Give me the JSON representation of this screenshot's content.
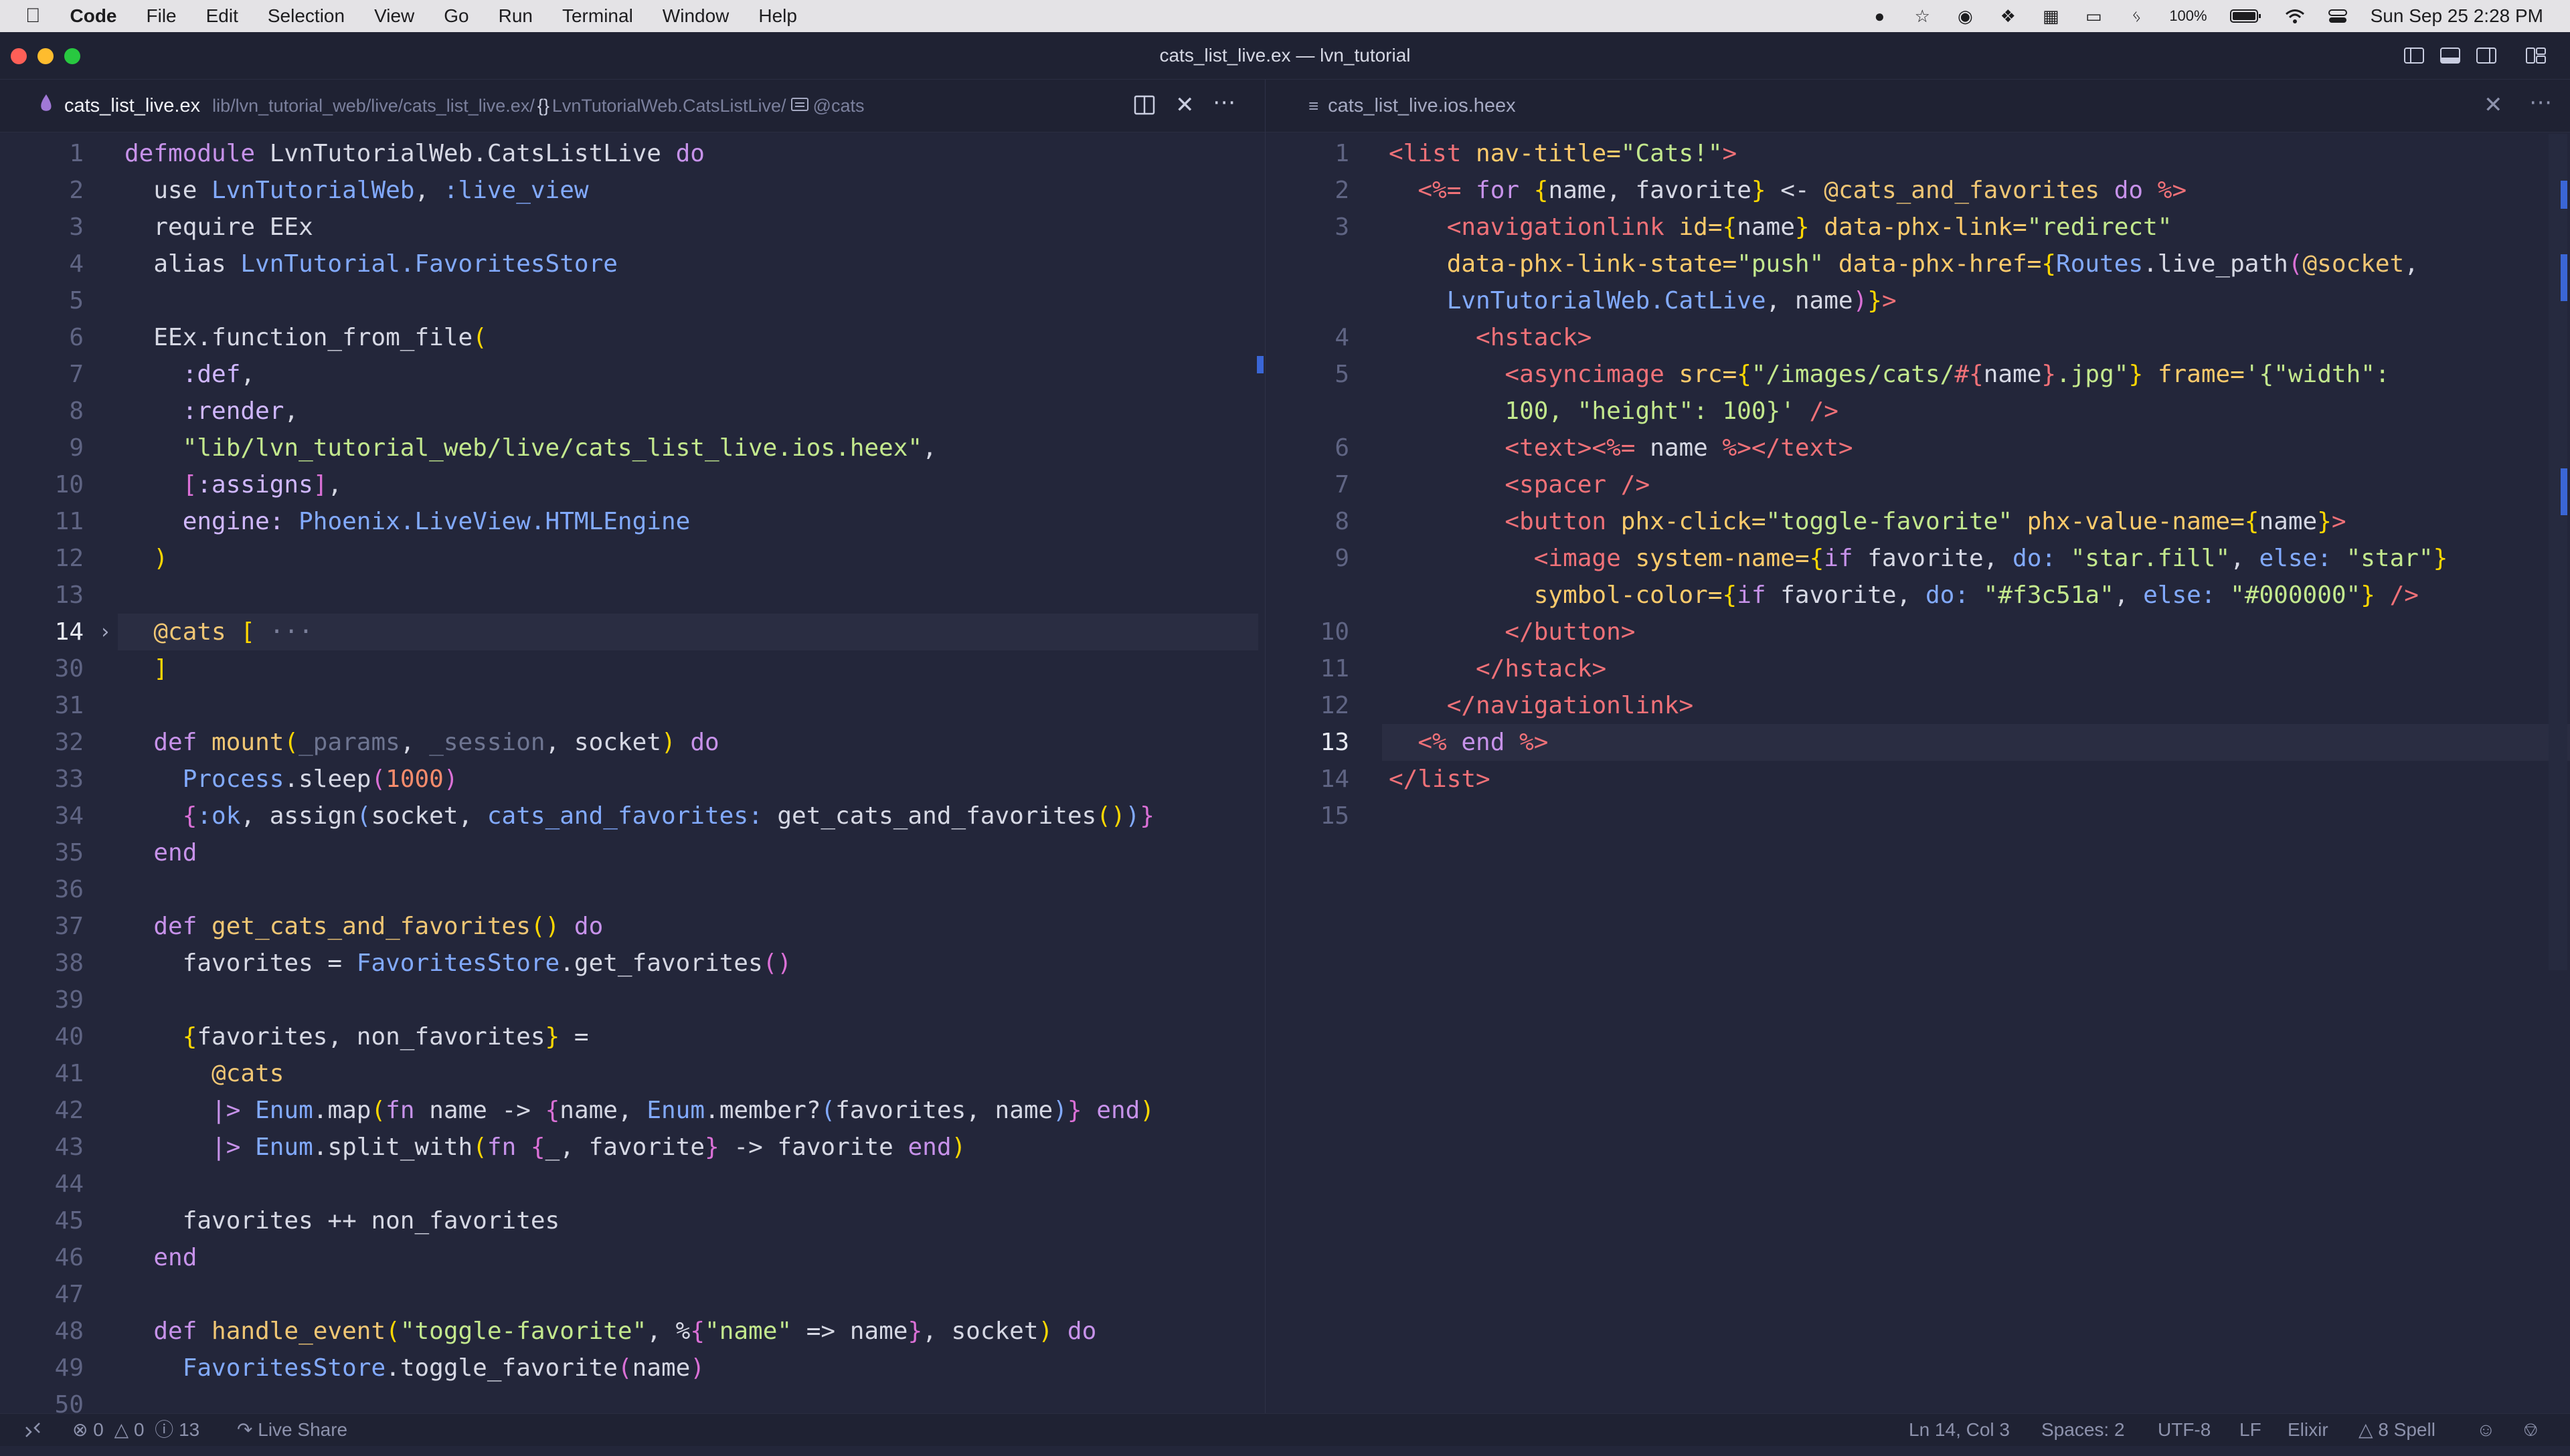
{
  "menubar": {
    "items": [
      "Code",
      "File",
      "Edit",
      "Selection",
      "View",
      "Go",
      "Run",
      "Terminal",
      "Window",
      "Help"
    ],
    "battery": "100%",
    "datetime": "Sun Sep 25  2:28 PM"
  },
  "window": {
    "title": "cats_list_live.ex — lvn_tutorial"
  },
  "left_tab": {
    "name": "cats_list_live.ex",
    "breadcrumb_path": "lib/lvn_tutorial_web/live/cats_list_live.ex/",
    "breadcrumb_module": "LvnTutorialWeb.CatsListLive/",
    "breadcrumb_attr": "@cats"
  },
  "right_tab": {
    "name": "cats_list_live.ios.heex"
  },
  "left_lines": [
    {
      "n": "1",
      "t": [
        [
          "defmodule ",
          "#c792ea"
        ],
        [
          "LvnTutorialWeb.CatsListLive ",
          "#d6d8e4"
        ],
        [
          "do",
          "#c792ea"
        ]
      ]
    },
    {
      "n": "2",
      "t": [
        [
          "  use ",
          "#d6d8e4"
        ],
        [
          "LvnTutorialWeb",
          "#82aaff"
        ],
        [
          ", ",
          "#d6d8e4"
        ],
        [
          ":live_view",
          "#82aaff"
        ]
      ]
    },
    {
      "n": "3",
      "t": [
        [
          "  require EEx",
          "#d6d8e4"
        ]
      ]
    },
    {
      "n": "4",
      "t": [
        [
          "  alias ",
          "#d6d8e4"
        ],
        [
          "LvnTutorial.FavoritesStore",
          "#82aaff"
        ]
      ]
    },
    {
      "n": "5",
      "t": []
    },
    {
      "n": "6",
      "t": [
        [
          "  EEx.function_from_file",
          "#d6d8e4"
        ],
        [
          "(",
          "#ffd700"
        ]
      ]
    },
    {
      "n": "7",
      "t": [
        [
          "    :def",
          "#d0b7ff"
        ],
        [
          ",",
          "#d6d8e4"
        ]
      ]
    },
    {
      "n": "8",
      "t": [
        [
          "    :render",
          "#d0b7ff"
        ],
        [
          ",",
          "#d6d8e4"
        ]
      ]
    },
    {
      "n": "9",
      "t": [
        [
          "    \"lib/lvn_tutorial_web/live/cats_list_live.ios.heex\"",
          "#c3e88d"
        ],
        [
          ",",
          "#d6d8e4"
        ]
      ]
    },
    {
      "n": "10",
      "t": [
        [
          "    [",
          "#da70d6"
        ],
        [
          ":assigns",
          "#d0b7ff"
        ],
        [
          "]",
          "#da70d6"
        ],
        [
          ",",
          "#d6d8e4"
        ]
      ]
    },
    {
      "n": "11",
      "t": [
        [
          "    engine: ",
          "#d0b7ff"
        ],
        [
          "Phoenix.LiveView.HTMLEngine",
          "#82aaff"
        ]
      ]
    },
    {
      "n": "12",
      "t": [
        [
          "  )",
          "#ffd700"
        ]
      ]
    },
    {
      "n": "13",
      "t": []
    },
    {
      "n": "14",
      "t": [
        [
          "  @cats ",
          "#f0c674"
        ],
        [
          "[",
          "#ffd700"
        ],
        [
          " ···",
          "#7a7f9a"
        ]
      ],
      "active": true,
      "fold": true
    },
    {
      "n": "30",
      "t": [
        [
          "  ]",
          "#ffd700"
        ]
      ]
    },
    {
      "n": "31",
      "t": []
    },
    {
      "n": "32",
      "t": [
        [
          "  def ",
          "#c792ea"
        ],
        [
          "mount",
          "#f0c674"
        ],
        [
          "(",
          "#ffd700"
        ],
        [
          "_params",
          "#6e7591"
        ],
        [
          ", ",
          "#d6d8e4"
        ],
        [
          "_session",
          "#6e7591"
        ],
        [
          ", socket",
          "#d6d8e4"
        ],
        [
          ") ",
          "#ffd700"
        ],
        [
          "do",
          "#c792ea"
        ]
      ]
    },
    {
      "n": "33",
      "t": [
        [
          "    Process",
          "#82aaff"
        ],
        [
          ".sleep",
          "#d6d8e4"
        ],
        [
          "(",
          "#da70d6"
        ],
        [
          "1000",
          "#f78c6c"
        ],
        [
          ")",
          "#da70d6"
        ]
      ]
    },
    {
      "n": "34",
      "t": [
        [
          "    {",
          "#da70d6"
        ],
        [
          ":ok",
          "#82aaff"
        ],
        [
          ", assign",
          "#d6d8e4"
        ],
        [
          "(",
          "#82aaff"
        ],
        [
          "socket, ",
          "#d6d8e4"
        ],
        [
          "cats_and_favorites: ",
          "#82aaff"
        ],
        [
          "get_cats_and_favorites",
          "#d6d8e4"
        ],
        [
          "()",
          "#ffd700"
        ],
        [
          ")",
          "#82aaff"
        ],
        [
          "}",
          "#da70d6"
        ]
      ]
    },
    {
      "n": "35",
      "t": [
        [
          "  end",
          "#c792ea"
        ]
      ]
    },
    {
      "n": "36",
      "t": []
    },
    {
      "n": "37",
      "t": [
        [
          "  def ",
          "#c792ea"
        ],
        [
          "get_cats_and_favorites",
          "#f0c674"
        ],
        [
          "() ",
          "#ffd700"
        ],
        [
          "do",
          "#c792ea"
        ]
      ]
    },
    {
      "n": "38",
      "t": [
        [
          "    favorites = ",
          "#d6d8e4"
        ],
        [
          "FavoritesStore",
          "#82aaff"
        ],
        [
          ".get_favorites",
          "#d6d8e4"
        ],
        [
          "()",
          "#da70d6"
        ]
      ]
    },
    {
      "n": "39",
      "t": []
    },
    {
      "n": "40",
      "t": [
        [
          "    {",
          "#ffd700"
        ],
        [
          "favorites, non_favorites",
          "#d6d8e4"
        ],
        [
          "}",
          "#ffd700"
        ],
        [
          " =",
          "#d6d8e4"
        ]
      ]
    },
    {
      "n": "41",
      "t": [
        [
          "      @cats",
          "#f0c674"
        ]
      ]
    },
    {
      "n": "42",
      "t": [
        [
          "      |> ",
          "#c792ea"
        ],
        [
          "Enum",
          "#82aaff"
        ],
        [
          ".map",
          "#d6d8e4"
        ],
        [
          "(",
          "#ffd700"
        ],
        [
          "fn ",
          "#c792ea"
        ],
        [
          "name -> ",
          "#d6d8e4"
        ],
        [
          "{",
          "#da70d6"
        ],
        [
          "name, ",
          "#d6d8e4"
        ],
        [
          "Enum",
          "#82aaff"
        ],
        [
          ".member?",
          "#d6d8e4"
        ],
        [
          "(",
          "#82aaff"
        ],
        [
          "favorites, name",
          "#d6d8e4"
        ],
        [
          ")",
          "#82aaff"
        ],
        [
          "} ",
          "#da70d6"
        ],
        [
          "end",
          "#c792ea"
        ],
        [
          ")",
          "#ffd700"
        ]
      ]
    },
    {
      "n": "43",
      "t": [
        [
          "      |> ",
          "#c792ea"
        ],
        [
          "Enum",
          "#82aaff"
        ],
        [
          ".split_with",
          "#d6d8e4"
        ],
        [
          "(",
          "#ffd700"
        ],
        [
          "fn ",
          "#c792ea"
        ],
        [
          "{",
          "#da70d6"
        ],
        [
          "_, favorite",
          "#d6d8e4"
        ],
        [
          "} ",
          "#da70d6"
        ],
        [
          "-> favorite ",
          "#d6d8e4"
        ],
        [
          "end",
          "#c792ea"
        ],
        [
          ")",
          "#ffd700"
        ]
      ]
    },
    {
      "n": "44",
      "t": []
    },
    {
      "n": "45",
      "t": [
        [
          "    favorites ++ non_favorites",
          "#d6d8e4"
        ]
      ]
    },
    {
      "n": "46",
      "t": [
        [
          "  end",
          "#c792ea"
        ]
      ]
    },
    {
      "n": "47",
      "t": []
    },
    {
      "n": "48",
      "t": [
        [
          "  def ",
          "#c792ea"
        ],
        [
          "handle_event",
          "#f0c674"
        ],
        [
          "(",
          "#ffd700"
        ],
        [
          "\"toggle-favorite\"",
          "#c3e88d"
        ],
        [
          ", %",
          "#d6d8e4"
        ],
        [
          "{",
          "#da70d6"
        ],
        [
          "\"name\"",
          "#c3e88d"
        ],
        [
          " => name",
          "#d6d8e4"
        ],
        [
          "}",
          "#da70d6"
        ],
        [
          ", socket",
          "#d6d8e4"
        ],
        [
          ") ",
          "#ffd700"
        ],
        [
          "do",
          "#c792ea"
        ]
      ]
    },
    {
      "n": "49",
      "t": [
        [
          "    FavoritesStore",
          "#82aaff"
        ],
        [
          ".toggle_favorite",
          "#d6d8e4"
        ],
        [
          "(",
          "#da70d6"
        ],
        [
          "name",
          "#d6d8e4"
        ],
        [
          ")",
          "#da70d6"
        ]
      ]
    },
    {
      "n": "50",
      "t": []
    }
  ],
  "right_lines": [
    {
      "n": "1",
      "t": [
        [
          "<list ",
          "#f07178"
        ],
        [
          "nav-title=",
          "#ffcb6b"
        ],
        [
          "\"Cats!\"",
          "#c3e88d"
        ],
        [
          ">",
          "#f07178"
        ]
      ]
    },
    {
      "n": "2",
      "t": [
        [
          "  <%= ",
          "#f07178"
        ],
        [
          "for ",
          "#c792ea"
        ],
        [
          "{",
          "#ffd700"
        ],
        [
          "name, favorite",
          "#d6d8e4"
        ],
        [
          "}",
          "#ffd700"
        ],
        [
          " <- ",
          "#d6d8e4"
        ],
        [
          "@cats_and_favorites ",
          "#f0c674"
        ],
        [
          "do ",
          "#c792ea"
        ],
        [
          "%>",
          "#f07178"
        ]
      ]
    },
    {
      "n": "3",
      "t": [
        [
          "    <",
          "#f07178"
        ],
        [
          "navigationlink",
          "#f07178"
        ],
        [
          " id=",
          "#ffcb6b"
        ],
        [
          "{",
          "#ffd700"
        ],
        [
          "name",
          "#d6d8e4"
        ],
        [
          "}",
          "#ffd700"
        ],
        [
          " data-phx-link=",
          "#ffcb6b"
        ],
        [
          "\"redirect\"",
          "#c3e88d"
        ]
      ]
    },
    {
      "n": "",
      "t": [
        [
          "    data-phx-link-state=",
          "#ffcb6b"
        ],
        [
          "\"push\"",
          "#c3e88d"
        ],
        [
          " data-phx-href=",
          "#ffcb6b"
        ],
        [
          "{",
          "#ffd700"
        ],
        [
          "Routes",
          "#82aaff"
        ],
        [
          ".live_path",
          "#d6d8e4"
        ],
        [
          "(",
          "#da70d6"
        ],
        [
          "@socket",
          "#f0c674"
        ],
        [
          ",",
          "#d6d8e4"
        ]
      ]
    },
    {
      "n": "",
      "t": [
        [
          "    LvnTutorialWeb.CatLive",
          "#82aaff"
        ],
        [
          ", name",
          "#d6d8e4"
        ],
        [
          ")",
          "#da70d6"
        ],
        [
          "}",
          "#ffd700"
        ],
        [
          ">",
          "#f07178"
        ]
      ]
    },
    {
      "n": "4",
      "t": [
        [
          "      <",
          "#f07178"
        ],
        [
          "hstack",
          "#f07178"
        ],
        [
          ">",
          "#f07178"
        ]
      ]
    },
    {
      "n": "5",
      "t": [
        [
          "        <",
          "#f07178"
        ],
        [
          "asyncimage",
          "#f07178"
        ],
        [
          " src=",
          "#ffcb6b"
        ],
        [
          "{",
          "#ffd700"
        ],
        [
          "\"/images/cats/",
          "#c3e88d"
        ],
        [
          "#{",
          "#f07178"
        ],
        [
          "name",
          "#d6d8e4"
        ],
        [
          "}",
          "#f07178"
        ],
        [
          ".jpg\"",
          "#c3e88d"
        ],
        [
          "}",
          "#ffd700"
        ],
        [
          " frame=",
          "#ffcb6b"
        ],
        [
          "'{\"width\":",
          "#c3e88d"
        ]
      ]
    },
    {
      "n": "",
      "t": [
        [
          "        100, \"height\": 100}'",
          "#c3e88d"
        ],
        [
          " />",
          "#f07178"
        ]
      ]
    },
    {
      "n": "6",
      "t": [
        [
          "        <text>",
          "#f07178"
        ],
        [
          "<%= ",
          "#f07178"
        ],
        [
          "name ",
          "#d6d8e4"
        ],
        [
          "%>",
          "#f07178"
        ],
        [
          "</text>",
          "#f07178"
        ]
      ]
    },
    {
      "n": "7",
      "t": [
        [
          "        <spacer />",
          "#f07178"
        ]
      ]
    },
    {
      "n": "8",
      "t": [
        [
          "        <button ",
          "#f07178"
        ],
        [
          "phx-click=",
          "#ffcb6b"
        ],
        [
          "\"toggle-favorite\"",
          "#c3e88d"
        ],
        [
          " phx-value-name=",
          "#ffcb6b"
        ],
        [
          "{",
          "#ffd700"
        ],
        [
          "name",
          "#d6d8e4"
        ],
        [
          "}",
          "#ffd700"
        ],
        [
          ">",
          "#f07178"
        ]
      ]
    },
    {
      "n": "9",
      "t": [
        [
          "          <image ",
          "#f07178"
        ],
        [
          "system-name=",
          "#ffcb6b"
        ],
        [
          "{",
          "#ffd700"
        ],
        [
          "if ",
          "#c792ea"
        ],
        [
          "favorite, ",
          "#d6d8e4"
        ],
        [
          "do: ",
          "#82aaff"
        ],
        [
          "\"star.fill\"",
          "#c3e88d"
        ],
        [
          ", ",
          "#d6d8e4"
        ],
        [
          "else: ",
          "#82aaff"
        ],
        [
          "\"star\"",
          "#c3e88d"
        ],
        [
          "}",
          "#ffd700"
        ]
      ]
    },
    {
      "n": "",
      "t": [
        [
          "          symbol-color=",
          "#ffcb6b"
        ],
        [
          "{",
          "#ffd700"
        ],
        [
          "if ",
          "#c792ea"
        ],
        [
          "favorite, ",
          "#d6d8e4"
        ],
        [
          "do: ",
          "#82aaff"
        ],
        [
          "\"#f3c51a\"",
          "#c3e88d"
        ],
        [
          ", ",
          "#d6d8e4"
        ],
        [
          "else: ",
          "#82aaff"
        ],
        [
          "\"#000000\"",
          "#c3e88d"
        ],
        [
          "}",
          "#ffd700"
        ],
        [
          " />",
          "#f07178"
        ]
      ]
    },
    {
      "n": "10",
      "t": [
        [
          "        </button>",
          "#f07178"
        ]
      ]
    },
    {
      "n": "11",
      "t": [
        [
          "      </",
          "#f07178"
        ],
        [
          "hstack",
          "#f07178"
        ],
        [
          ">",
          "#f07178"
        ]
      ]
    },
    {
      "n": "12",
      "t": [
        [
          "    </",
          "#f07178"
        ],
        [
          "navigationlink",
          "#f07178"
        ],
        [
          ">",
          "#f07178"
        ]
      ]
    },
    {
      "n": "13",
      "t": [
        [
          "  <% ",
          "#f07178"
        ],
        [
          "end ",
          "#c792ea"
        ],
        [
          "%>",
          "#f07178"
        ]
      ],
      "active": true
    },
    {
      "n": "14",
      "t": [
        [
          "</list>",
          "#f07178"
        ]
      ]
    },
    {
      "n": "15",
      "t": []
    }
  ],
  "statusbar": {
    "errors": "0",
    "warnings": "0",
    "infos": "13",
    "live_share": "Live Share",
    "position": "Ln 14, Col 3",
    "spaces": "Spaces: 2",
    "encoding": "UTF-8",
    "eol": "LF",
    "language": "Elixir",
    "spell": "8 Spell"
  },
  "colors": {
    "editor_bg": "#23263a",
    "chrome_bg": "#1f2233",
    "line_number": "#5f6483",
    "line_number_active": "#e8eaf3",
    "active_line_bg": "#2a2d42"
  }
}
